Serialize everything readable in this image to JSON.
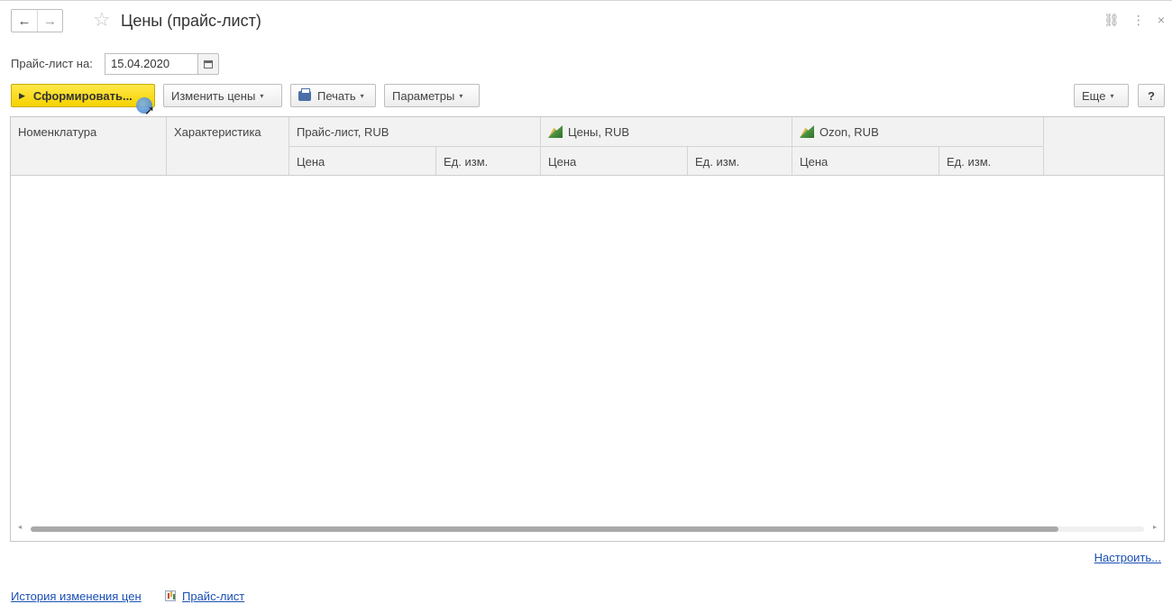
{
  "window": {
    "title": "Цены (прайс-лист)",
    "back_icon": "←",
    "forward_icon": "→",
    "star_icon": "☆",
    "link_icon": "🔗",
    "more_icon": "⋮",
    "close_icon": "×"
  },
  "date_field": {
    "label": "Прайс-лист на:",
    "value": "15.04.2020"
  },
  "toolbar": {
    "generate_label": "Сформировать...",
    "change_prices_label": "Изменить цены",
    "print_label": "Печать",
    "parameters_label": "Параметры",
    "more_label": "Еще",
    "help_label": "?",
    "dropdown_caret": "▾",
    "play_icon": "▶"
  },
  "table": {
    "columns": {
      "nomenclature": "Номенклатура",
      "characteristic": "Характеристика"
    },
    "groups": [
      {
        "label": "Прайс-лист, RUB",
        "price": "Цена",
        "unit": "Ед. изм.",
        "icon": null
      },
      {
        "label": "Цены, RUB",
        "price": "Цена",
        "unit": "Ед. изм.",
        "icon": "price-type-icon"
      },
      {
        "label": "Ozon, RUB",
        "price": "Цена",
        "unit": "Ед. изм.",
        "icon": "price-type-icon"
      }
    ],
    "rows": [],
    "scroll_arrows": {
      "left": "◂",
      "right": "▸"
    }
  },
  "footer": {
    "settings_link": "Настроить...",
    "history_link": "История изменения цен",
    "pricelist_link": "Прайс-лист"
  }
}
